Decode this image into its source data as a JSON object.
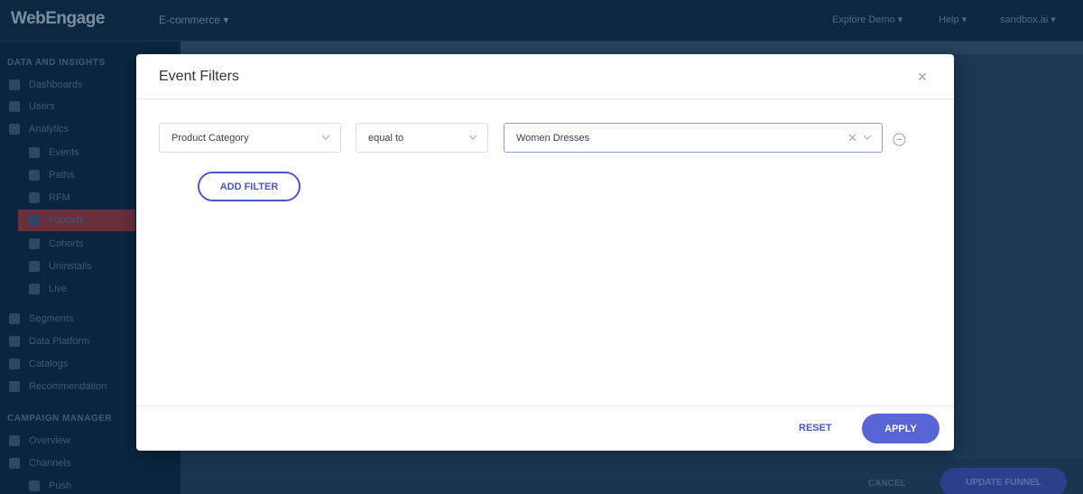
{
  "app": {
    "logo": "WebEngage",
    "project": "E-commerce ▾",
    "top_right": [
      "Explore Demo ▾",
      "Help ▾",
      "sandbox.ai ▾"
    ]
  },
  "sidebar": {
    "sections": [
      {
        "label": "DATA AND INSIGHTS"
      },
      {
        "label": "CAMPAIGN MANAGER"
      }
    ],
    "items": [
      {
        "label": "Dashboards",
        "icon": "dashboard-icon"
      },
      {
        "label": "Users",
        "icon": "users-icon"
      },
      {
        "label": "Analytics",
        "icon": "analytics-icon"
      },
      {
        "label": "Events",
        "icon": "events-icon"
      },
      {
        "label": "Paths",
        "icon": "paths-icon"
      },
      {
        "label": "RFM",
        "icon": "rfm-icon"
      },
      {
        "label": "Funnels",
        "icon": "funnel-icon"
      },
      {
        "label": "Cohorts",
        "icon": "cohorts-icon"
      },
      {
        "label": "Uninstalls",
        "icon": "uninstalls-icon"
      },
      {
        "label": "Live",
        "icon": "live-icon"
      },
      {
        "label": "Segments",
        "icon": "segments-icon"
      },
      {
        "label": "Data Platform",
        "icon": "data-platform-icon"
      },
      {
        "label": "Catalogs",
        "icon": "catalogs-icon"
      },
      {
        "label": "Recommendation",
        "icon": "recommendation-icon"
      },
      {
        "label": "Overview",
        "icon": "overview-icon"
      },
      {
        "label": "Channels",
        "icon": "channels-icon"
      },
      {
        "label": "Push",
        "icon": "push-icon"
      }
    ]
  },
  "background_footer": {
    "cancel_label": "CANCEL",
    "update_label": "UPDATE FUNNEL"
  },
  "modal": {
    "title": "Event Filters",
    "close_icon": "close-icon",
    "filter": {
      "attribute": "Product Category",
      "operator": "equal to",
      "value": "Women Dresses"
    },
    "add_filter_label": "ADD FILTER",
    "reset_label": "RESET",
    "apply_label": "APPLY"
  },
  "colors": {
    "accent": "#4b56c9",
    "apply_bg": "#5865d6",
    "overlay": "#0f2a44"
  }
}
